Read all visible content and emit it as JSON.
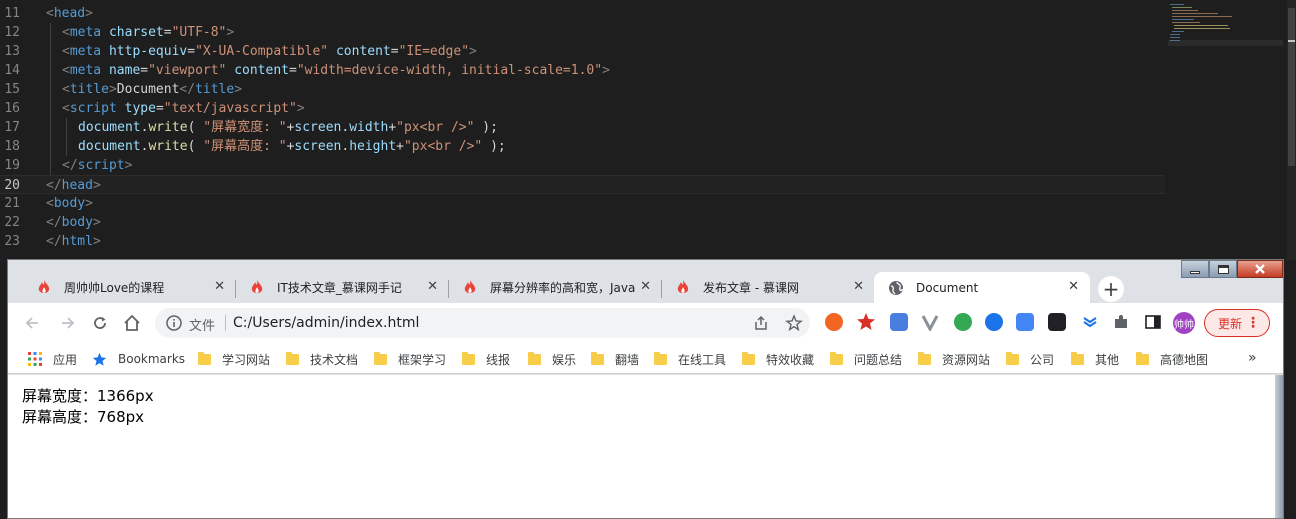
{
  "editor": {
    "active_line": "20",
    "lines": [
      {
        "num": "11",
        "indent": 0,
        "tokens": [
          [
            "br",
            "<"
          ],
          [
            "tag",
            "head"
          ],
          [
            "br",
            ">"
          ]
        ]
      },
      {
        "num": "12",
        "indent": 1,
        "tokens": [
          [
            "br",
            "<"
          ],
          [
            "tag",
            "meta "
          ],
          [
            "attr",
            "charset"
          ],
          [
            "txt",
            "="
          ],
          [
            "str",
            "\"UTF-8\""
          ],
          [
            "br",
            ">"
          ]
        ]
      },
      {
        "num": "13",
        "indent": 1,
        "tokens": [
          [
            "br",
            "<"
          ],
          [
            "tag",
            "meta "
          ],
          [
            "attr",
            "http-equiv"
          ],
          [
            "txt",
            "="
          ],
          [
            "str",
            "\"X-UA-Compatible\" "
          ],
          [
            "attr",
            "content"
          ],
          [
            "txt",
            "="
          ],
          [
            "str",
            "\"IE=edge\""
          ],
          [
            "br",
            ">"
          ]
        ]
      },
      {
        "num": "14",
        "indent": 1,
        "tokens": [
          [
            "br",
            "<"
          ],
          [
            "tag",
            "meta "
          ],
          [
            "attr",
            "name"
          ],
          [
            "txt",
            "="
          ],
          [
            "str",
            "\"viewport\" "
          ],
          [
            "attr",
            "content"
          ],
          [
            "txt",
            "="
          ],
          [
            "str",
            "\"width=device-width, initial-scale=1.0\""
          ],
          [
            "br",
            ">"
          ]
        ]
      },
      {
        "num": "15",
        "indent": 1,
        "tokens": [
          [
            "br",
            "<"
          ],
          [
            "tag",
            "title"
          ],
          [
            "br",
            ">"
          ],
          [
            "txt",
            "Document"
          ],
          [
            "br",
            "</"
          ],
          [
            "tag",
            "title"
          ],
          [
            "br",
            ">"
          ]
        ]
      },
      {
        "num": "16",
        "indent": 1,
        "tokens": [
          [
            "br",
            "<"
          ],
          [
            "tag",
            "script "
          ],
          [
            "attr",
            "type"
          ],
          [
            "txt",
            "="
          ],
          [
            "str",
            "\"text/javascript\""
          ],
          [
            "br",
            ">"
          ]
        ]
      },
      {
        "num": "17",
        "indent": 2,
        "tokens": [
          [
            "attr",
            "document"
          ],
          [
            "txt",
            "."
          ],
          [
            "fn",
            "write"
          ],
          [
            "txt",
            "( "
          ],
          [
            "str",
            "\"屏幕宽度: \""
          ],
          [
            "txt",
            "+"
          ],
          [
            "attr",
            "screen"
          ],
          [
            "txt",
            "."
          ],
          [
            "attr",
            "width"
          ],
          [
            "txt",
            "+"
          ],
          [
            "str",
            "\"px<br />\""
          ],
          [
            "txt",
            " );"
          ]
        ]
      },
      {
        "num": "18",
        "indent": 2,
        "tokens": [
          [
            "attr",
            "document"
          ],
          [
            "txt",
            "."
          ],
          [
            "fn",
            "write"
          ],
          [
            "txt",
            "( "
          ],
          [
            "str",
            "\"屏幕高度: \""
          ],
          [
            "txt",
            "+"
          ],
          [
            "attr",
            "screen"
          ],
          [
            "txt",
            "."
          ],
          [
            "attr",
            "height"
          ],
          [
            "txt",
            "+"
          ],
          [
            "str",
            "\"px<br />\""
          ],
          [
            "txt",
            " );"
          ]
        ]
      },
      {
        "num": "19",
        "indent": 1,
        "tokens": [
          [
            "br",
            "</"
          ],
          [
            "tag",
            "script"
          ],
          [
            "br",
            ">"
          ]
        ]
      },
      {
        "num": "20",
        "indent": 0,
        "tokens": [
          [
            "br",
            "</"
          ],
          [
            "tag",
            "head"
          ],
          [
            "br",
            ">"
          ]
        ]
      },
      {
        "num": "21",
        "indent": 0,
        "tokens": [
          [
            "br",
            "<"
          ],
          [
            "tag",
            "body"
          ],
          [
            "br",
            ">"
          ]
        ]
      },
      {
        "num": "22",
        "indent": 0,
        "tokens": [
          [
            "br",
            "</"
          ],
          [
            "tag",
            "body"
          ],
          [
            "br",
            ">"
          ]
        ]
      },
      {
        "num": "23",
        "indent": 0,
        "tokens": [
          [
            "br",
            "</"
          ],
          [
            "tag",
            "html"
          ],
          [
            "br",
            ">"
          ]
        ]
      }
    ]
  },
  "browser": {
    "tabs": [
      {
        "title": "周帅帅Love的课程",
        "icon": "flame-icon",
        "active": false
      },
      {
        "title": "IT技术文章_慕课网手记",
        "icon": "flame-icon",
        "active": false
      },
      {
        "title": "屏幕分辨率的高和宽，JavaS",
        "icon": "flame-icon",
        "active": false
      },
      {
        "title": "发布文章 - 慕课网",
        "icon": "flame-icon",
        "active": false
      },
      {
        "title": "Document",
        "icon": "globe-icon",
        "active": true
      }
    ],
    "tab_close_glyph": "✕",
    "new_tab_glyph": "+",
    "address": {
      "scheme_label": "文件",
      "url": "C:/Users/admin/index.html"
    },
    "avatar_text": "帅帅",
    "update_label": "更新",
    "bookmarks": {
      "apps_label": "应用",
      "bookmarks_label": "Bookmarks",
      "folders": [
        "学习网站",
        "技术文档",
        "框架学习",
        "线报",
        "娱乐",
        "翻墙",
        "在线工具",
        "特效收藏",
        "问题总结",
        "资源网站",
        "公司",
        "其他",
        "高德地图"
      ],
      "more_glyph": "»"
    },
    "page": {
      "line1": "屏幕宽度：1366px",
      "line2": "屏幕高度：768px"
    },
    "colors": {
      "flame": "#e8443a",
      "accent": "#1a73e8",
      "update": "#d93025"
    }
  }
}
